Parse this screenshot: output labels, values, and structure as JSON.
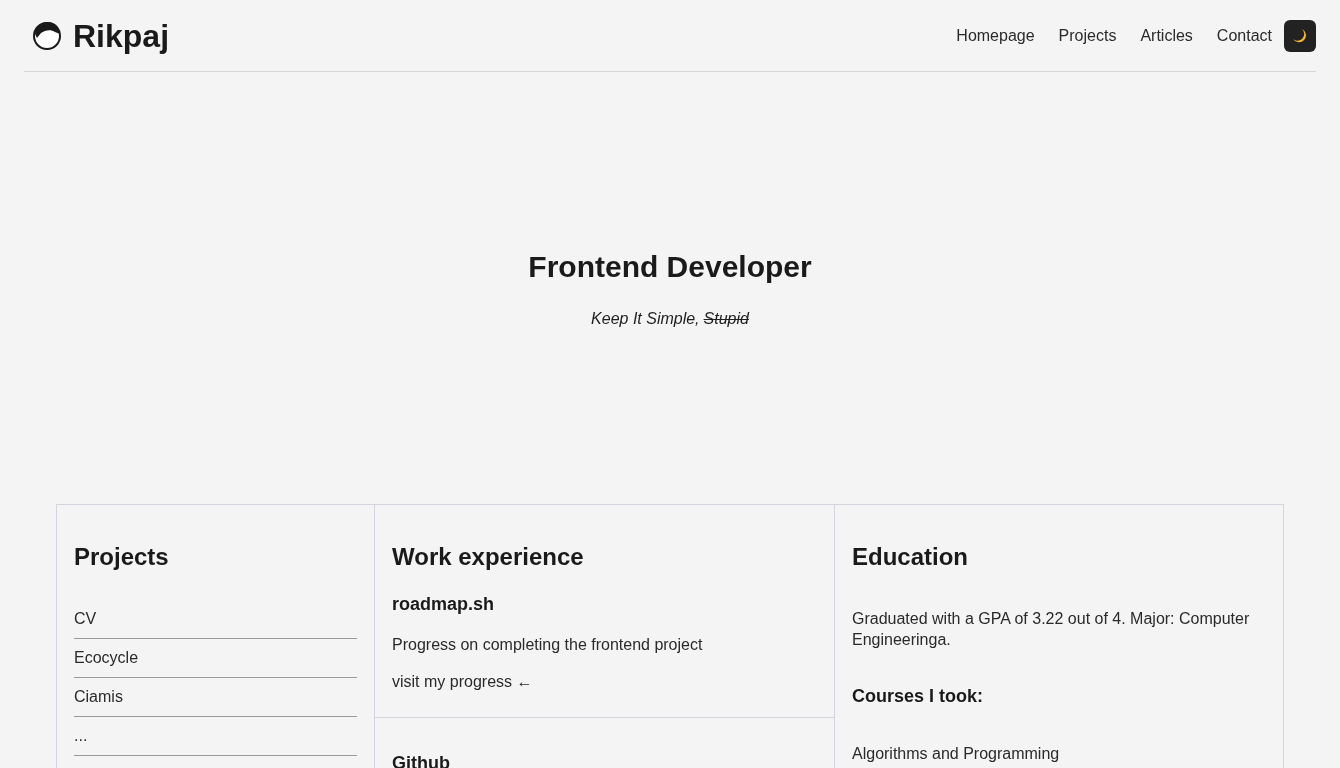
{
  "header": {
    "logo_text": "Rikpaj",
    "nav": [
      {
        "label": "Homepage"
      },
      {
        "label": "Projects"
      },
      {
        "label": "Articles"
      },
      {
        "label": "Contact"
      }
    ]
  },
  "hero": {
    "title": "Frontend Developer",
    "tagline": [
      {
        "text": "Keep It Simple,",
        "struck": false
      },
      {
        "text": "Stupid",
        "struck": true
      }
    ]
  },
  "projects": {
    "title": "Projects",
    "items": [
      "CV",
      "Ecocycle",
      "Ciamis",
      "..."
    ]
  },
  "work_experience": {
    "title": "Work experience",
    "entries": [
      {
        "name": "roadmap.sh",
        "description": "Progress on completing the frontend project",
        "link": "visit my progress ←"
      },
      {
        "name": "Github"
      }
    ]
  },
  "education": {
    "title": "Education",
    "summary": "Graduated with a GPA of 3.22 out of 4. Major: Computer Engineeringa.",
    "courses_title": "Courses I took:",
    "courses": [
      "Algorithms and Programming"
    ]
  }
}
